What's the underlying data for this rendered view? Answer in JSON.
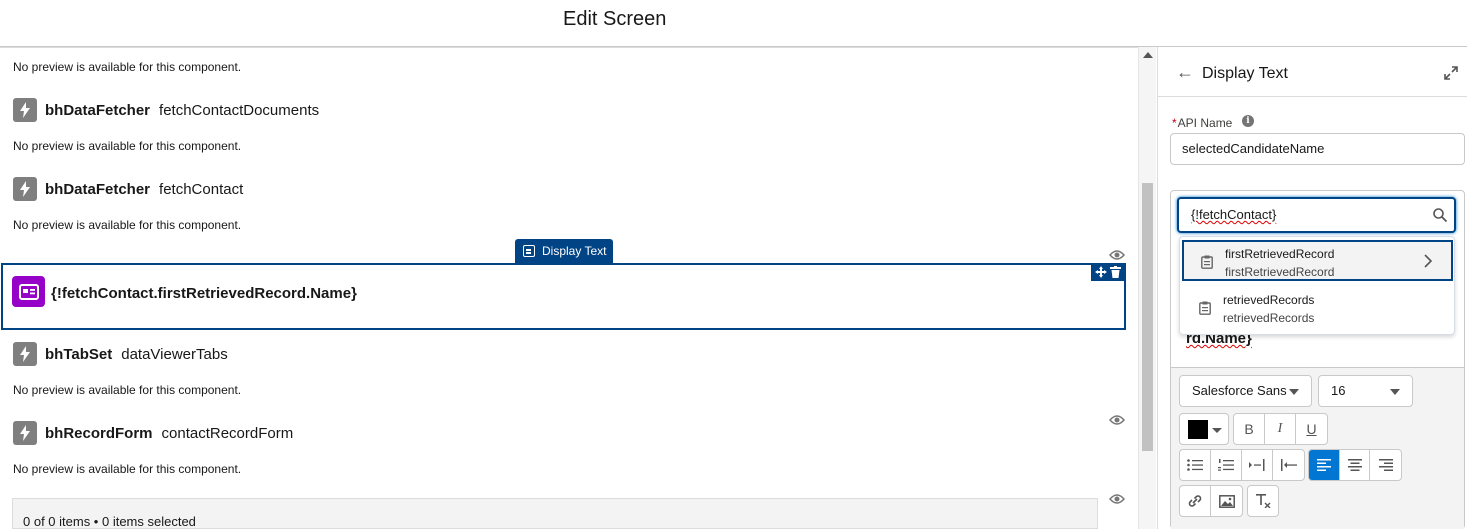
{
  "header": {
    "title": "Edit Screen"
  },
  "canvas": {
    "preview_note": "No preview is available for this component.",
    "components": [
      {
        "type": "bhDataFetcher",
        "name": "fetchContactDocuments"
      },
      {
        "type": "bhDataFetcher",
        "name": "fetchContact"
      },
      {
        "type": "bhTabSet",
        "name": "dataViewerTabs"
      },
      {
        "type": "bhRecordForm",
        "name": "contactRecordForm"
      }
    ],
    "selected": {
      "tag_label": "Display Text",
      "content": "{!fetchContact.firstRetrievedRecord.Name}"
    },
    "table_status": "0 of 0 items • 0 items selected"
  },
  "panel": {
    "title": "Display Text",
    "api_name_label": "API Name",
    "api_name_required": "*",
    "api_name_value": "selectedCandidateName",
    "search_value": "{!fetchContact}",
    "rte_visible_text": "rd.Name}",
    "font_family": "Salesforce Sans",
    "font_size": "16",
    "text_color": "#000000",
    "format_buttons": [
      "B",
      "I",
      "U"
    ],
    "dropdown": [
      {
        "title": "firstRetrievedRecord",
        "subtitle": "firstRetrievedRecord"
      },
      {
        "title": "retrievedRecords",
        "subtitle": "retrievedRecords"
      }
    ]
  },
  "colors": {
    "brand_dark": "#014486",
    "brand": "#0176d3",
    "display_text_icon": "#9602c7",
    "bolt_icon": "#7f7f7f"
  }
}
